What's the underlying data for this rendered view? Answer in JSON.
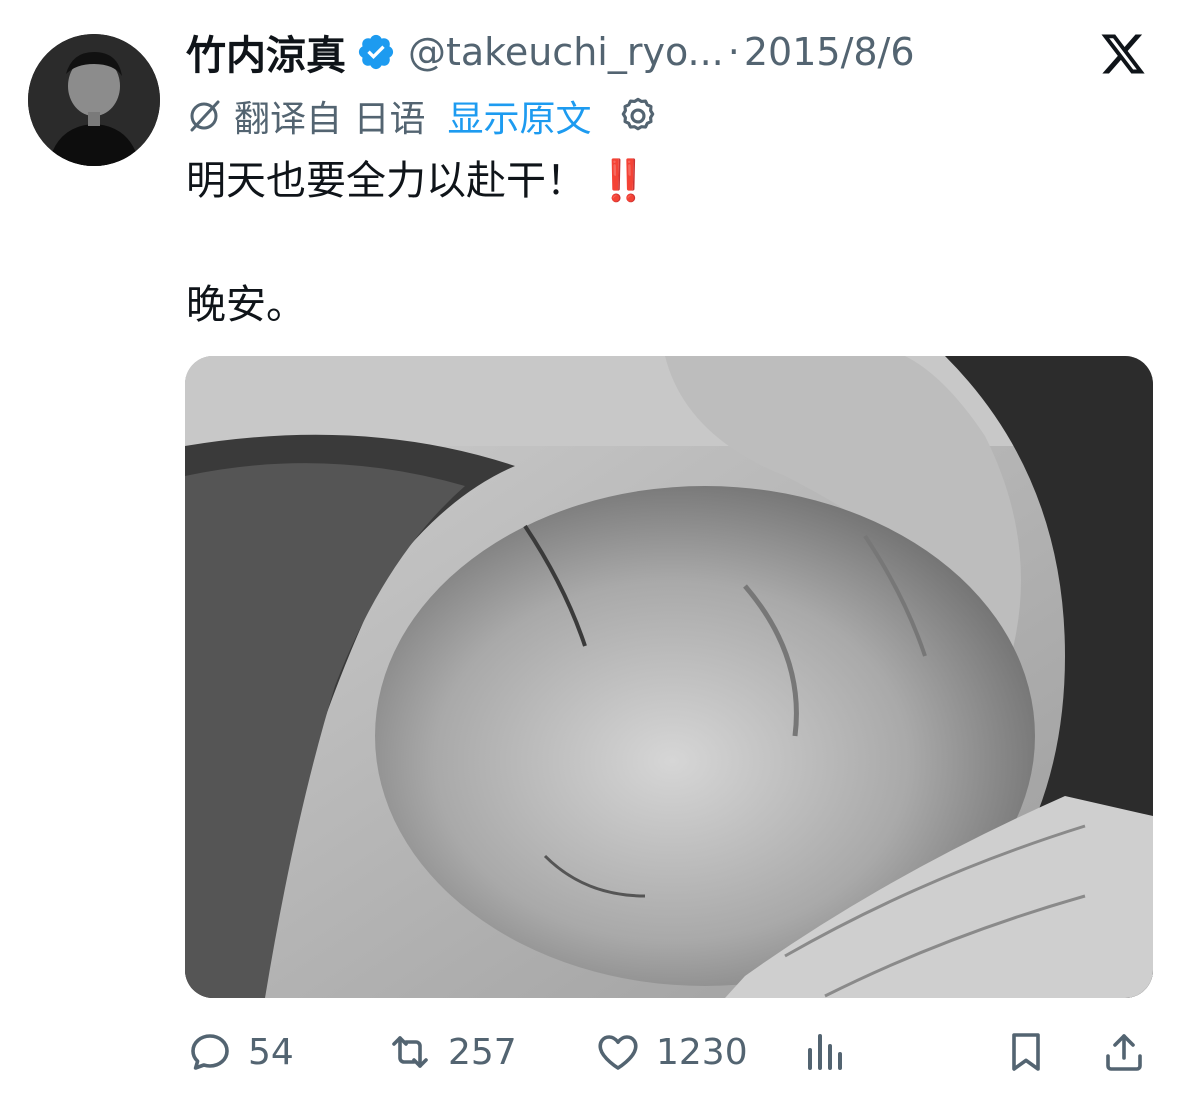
{
  "author": {
    "display_name": "竹内涼真",
    "handle": "@takeuchi_ryo...",
    "separator": "·",
    "date": "2015/8/6"
  },
  "translation": {
    "translated_from": "翻译自 日语",
    "show_original": "显示原文"
  },
  "tweet": {
    "line1": "明天也要全力以赴干！",
    "line1_emoji": "‼️",
    "line2": "晚安。"
  },
  "actions": {
    "replies": "54",
    "retweets": "257",
    "likes": "1230"
  },
  "icons": {
    "verified": "verified-badge-icon",
    "brand": "x-logo-icon",
    "translate": "translate-icon",
    "settings": "gear-icon",
    "reply": "reply-icon",
    "retweet": "retweet-icon",
    "like": "heart-icon",
    "views": "views-icon",
    "bookmark": "bookmark-icon",
    "share": "share-icon"
  },
  "colors": {
    "link": "#1d9bf0",
    "muted": "#536471",
    "text": "#0f1419",
    "emoji": "#e0245e"
  }
}
